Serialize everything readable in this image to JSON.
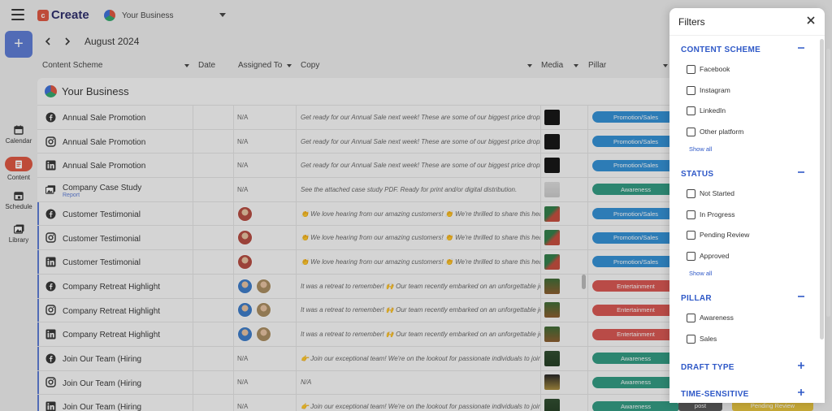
{
  "app": {
    "logo_text": "Create",
    "business_name": "Your Business"
  },
  "sidebar": {
    "items": [
      {
        "label": "Calendar",
        "icon": "calendar-icon"
      },
      {
        "label": "Content",
        "icon": "document-icon",
        "active": true
      },
      {
        "label": "Schedule",
        "icon": "schedule-icon"
      },
      {
        "label": "Library",
        "icon": "library-icon"
      }
    ]
  },
  "toolbar": {
    "month": "August 2024"
  },
  "columns": {
    "content_scheme": "Content Scheme",
    "date": "Date",
    "assigned_to": "Assigned To",
    "copy": "Copy",
    "media": "Media",
    "pillar": "Pillar"
  },
  "table": {
    "group_title": "Your Business",
    "rows": [
      {
        "platform": "facebook-icon",
        "name": "Annual Sale Promotion",
        "assigned": "N/A",
        "copy": "Get ready for our Annual Sale next week! These are some of our biggest price drops",
        "pillar": "Promotion/Sales"
      },
      {
        "platform": "instagram-icon",
        "name": "Annual Sale Promotion",
        "assigned": "N/A",
        "copy": "Get ready for our Annual Sale next week! These are some of our biggest price drops",
        "pillar": "Promotion/Sales"
      },
      {
        "platform": "linkedin-icon",
        "name": "Annual Sale Promotion",
        "assigned": "N/A",
        "copy": "Get ready for our Annual Sale next week! These are some of our biggest price drops",
        "pillar": "Promotion/Sales"
      },
      {
        "platform": "report-icon",
        "name": "Company Case Study",
        "sub": "Report",
        "assigned": "N/A",
        "copy": "See the attached case study PDF. Ready for print and/or digital distribution.",
        "pillar": "Awareness"
      },
      {
        "platform": "facebook-icon",
        "name": "Customer Testimonial",
        "assigned": "",
        "copy": "👏 We love hearing from our amazing customers! 👏 We're thrilled to share this hear",
        "pillar": "Promotion/Sales"
      },
      {
        "platform": "instagram-icon",
        "name": "Customer Testimonial",
        "assigned": "",
        "copy": "👏 We love hearing from our amazing customers! 👏 We're thrilled to share this hear",
        "pillar": "Promotion/Sales"
      },
      {
        "platform": "linkedin-icon",
        "name": "Customer Testimonial",
        "assigned": "",
        "copy": "👏 We love hearing from our amazing customers! 👏 We're thrilled to share this hear",
        "pillar": "Promotion/Sales"
      },
      {
        "platform": "facebook-icon",
        "name": "Company Retreat Highlight",
        "assigned": "",
        "copy": "It was a retreat to remember! 🙌 Our team recently embarked on an unforgettable jo",
        "pillar": "Entertainment"
      },
      {
        "platform": "instagram-icon",
        "name": "Company Retreat Highlight",
        "assigned": "",
        "copy": "It was a retreat to remember! 🙌 Our team recently embarked on an unforgettable jo",
        "pillar": "Entertainment"
      },
      {
        "platform": "linkedin-icon",
        "name": "Company Retreat Highlight",
        "assigned": "",
        "copy": "It was a retreat to remember! 🙌 Our team recently embarked on an unforgettable jo",
        "pillar": "Entertainment"
      },
      {
        "platform": "facebook-icon",
        "name": "Join Our Team (Hiring",
        "assigned": "N/A",
        "copy": "👉 Join our exceptional team! We're on the lookout for passionate individuals to join",
        "pillar": "Awareness"
      },
      {
        "platform": "instagram-icon",
        "name": "Join Our Team (Hiring",
        "assigned": "N/A",
        "copy": "N/A",
        "pillar": "Awareness"
      },
      {
        "platform": "linkedin-icon",
        "name": "Join Our Team (Hiring",
        "assigned": "N/A",
        "copy": "👉 Join our exceptional team! We're on the lookout for passionate individuals to join",
        "pillar": "Awareness"
      }
    ],
    "behind_drawer": {
      "type_value": "post",
      "status_value": "Pending Review"
    }
  },
  "filters": {
    "title": "Filters",
    "content_scheme": {
      "title": "CONTENT SCHEME",
      "options": [
        "Facebook",
        "Instagram",
        "LinkedIn",
        "Other platform"
      ],
      "show_all": "Show all"
    },
    "status": {
      "title": "STATUS",
      "options": [
        "Not Started",
        "In Progress",
        "Pending Review",
        "Approved"
      ],
      "show_all": "Show all"
    },
    "pillar": {
      "title": "PILLAR",
      "options": [
        "Awareness",
        "Sales"
      ]
    },
    "draft_type": {
      "title": "DRAFT TYPE"
    },
    "time_sensitive": {
      "title": "TIME-SENSITIVE"
    }
  },
  "colors": {
    "promotion_sales": "#2f8fd6",
    "awareness": "#2e9a80",
    "entertainment": "#d9534f",
    "accent": "#5b7bd6",
    "brand_red": "#e0533d",
    "filter_blue": "#2e58c7",
    "pending_review": "#e6c33a"
  }
}
